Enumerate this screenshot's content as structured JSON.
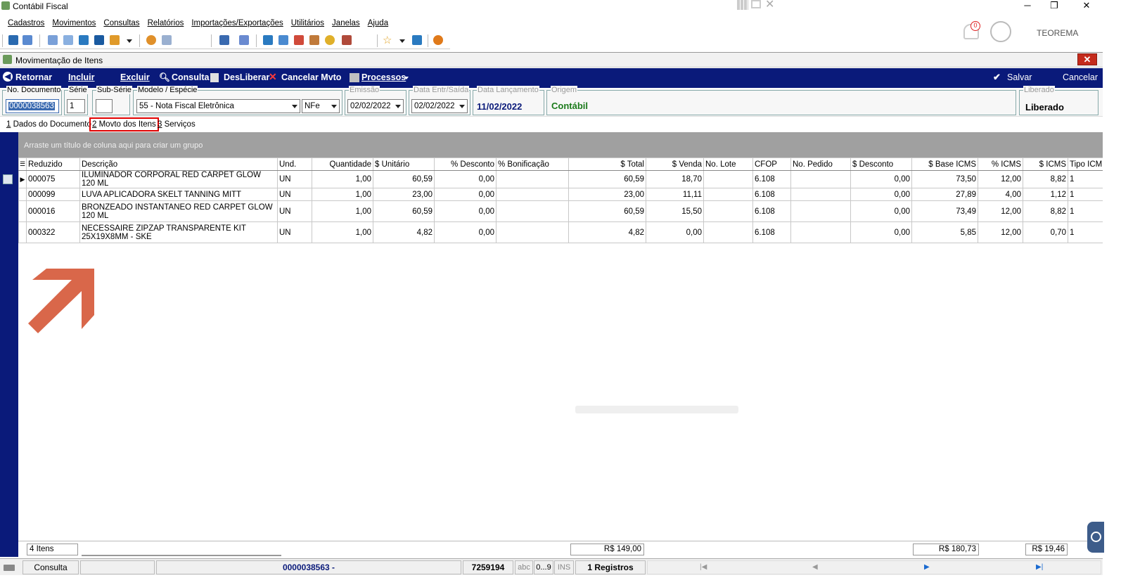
{
  "app": {
    "title": "Contábil Fiscal"
  },
  "window_controls": {
    "minimize": "─",
    "restore": "❐",
    "close": "✕"
  },
  "menu": [
    "Cadastros",
    "Movimentos",
    "Consultas",
    "Relatórios",
    "Importações/Exportações",
    "Utilitários",
    "Janelas",
    "Ajuda"
  ],
  "user_panel": {
    "notifications_count": "0",
    "username": "TEOREMA"
  },
  "form": {
    "title": "Movimentação de Itens",
    "close": "✕"
  },
  "actions": {
    "retornar": "Retornar",
    "incluir": "Incluir",
    "excluir": "Excluir",
    "consulta": "Consulta",
    "desliberar": "DesLiberar",
    "cancelar_mvto": "Cancelar Mvto",
    "processos": "Processos",
    "salvar": "Salvar",
    "cancelar": "Cancelar"
  },
  "header": {
    "no_documento": {
      "label": "No. Documento",
      "value": "0000038563"
    },
    "serie": {
      "label": "Série",
      "value": "1"
    },
    "sub_serie": {
      "label": "Sub-Série",
      "value": ""
    },
    "modelo": {
      "label": "Modelo / Espécie",
      "value": "55 - Nota Fiscal Eletrônica",
      "especie": "NFe"
    },
    "emissao": {
      "label": "Emissão",
      "value": "02/02/2022"
    },
    "data_entr_saida": {
      "label": "Data Entr/Saída",
      "value": "02/02/2022"
    },
    "data_lancamento": {
      "label": "Data Lançamento",
      "value": "11/02/2022"
    },
    "origem": {
      "label": "Origem",
      "value": "Contábil"
    },
    "liberado": {
      "label": "Liberado",
      "value": "Liberado"
    }
  },
  "tabs": [
    {
      "key": "1",
      "label": " Dados do Documento",
      "selected": false
    },
    {
      "key": "2",
      "label": " Movto dos Itens",
      "selected": true
    },
    {
      "key": "3",
      "label": " Serviços",
      "selected": false
    }
  ],
  "grid": {
    "group_hint": "Arraste um título de coluna aqui para criar um grupo",
    "columns": [
      "Reduzido",
      "Descrição",
      "Und.",
      "Quantidade",
      "$ Unitário",
      "% Desconto",
      "% Bonificação",
      "$ Total",
      "$ Venda",
      "No. Lote",
      "CFOP",
      "No. Pedido",
      "$ Desconto",
      "$ Base ICMS",
      "% ICMS",
      "$ ICMS",
      "Tipo ICM"
    ],
    "rows": [
      {
        "reduzido": "000075",
        "descricao": "ILUMINADOR CORPORAL RED CARPET GLOW 120 ML",
        "und": "UN",
        "quantidade": "1,00",
        "unitario": "60,59",
        "desconto_pct": "0,00",
        "bonificacao": "",
        "total": "60,59",
        "venda": "18,70",
        "lote": "",
        "cfop": "6.108",
        "pedido": "",
        "desconto": "0,00",
        "base_icms": "73,50",
        "icms_pct": "12,00",
        "icms": "8,82",
        "tipo_icm": "1"
      },
      {
        "reduzido": "000099",
        "descricao": "LUVA APLICADORA SKELT TANNING MITT",
        "und": "UN",
        "quantidade": "1,00",
        "unitario": "23,00",
        "desconto_pct": "0,00",
        "bonificacao": "",
        "total": "23,00",
        "venda": "11,11",
        "lote": "",
        "cfop": "6.108",
        "pedido": "",
        "desconto": "0,00",
        "base_icms": "27,89",
        "icms_pct": "4,00",
        "icms": "1,12",
        "tipo_icm": "1"
      },
      {
        "reduzido": "000016",
        "descricao": "BRONZEADO INSTANTANEO RED CARPET GLOW 120 ML",
        "und": "UN",
        "quantidade": "1,00",
        "unitario": "60,59",
        "desconto_pct": "0,00",
        "bonificacao": "",
        "total": "60,59",
        "venda": "15,50",
        "lote": "",
        "cfop": "6.108",
        "pedido": "",
        "desconto": "0,00",
        "base_icms": "73,49",
        "icms_pct": "12,00",
        "icms": "8,82",
        "tipo_icm": "1"
      },
      {
        "reduzido": "000322",
        "descricao": "NECESSAIRE ZIPZAP TRANSPARENTE KIT 25X19X8MM - SKE",
        "und": "UN",
        "quantidade": "1,00",
        "unitario": "4,82",
        "desconto_pct": "0,00",
        "bonificacao": "",
        "total": "4,82",
        "venda": "0,00",
        "lote": "",
        "cfop": "6.108",
        "pedido": "",
        "desconto": "0,00",
        "base_icms": "5,85",
        "icms_pct": "12,00",
        "icms": "0,70",
        "tipo_icm": "1"
      }
    ]
  },
  "footer": {
    "count": "4 Itens",
    "total": "R$ 149,00",
    "base_icms": "R$ 180,73",
    "icms": "R$ 19,46"
  },
  "status": {
    "mode": "Consulta",
    "doc": "0000038563 -",
    "code": "7259194",
    "abc": "abc",
    "num": "0...9",
    "ins": "INS",
    "registros": "1 Registros"
  },
  "colors": {
    "navy": "#0a1a7a",
    "origin_green": "#1a7a1a",
    "highlight_red": "#e00000",
    "arrow": "#d9674a"
  }
}
